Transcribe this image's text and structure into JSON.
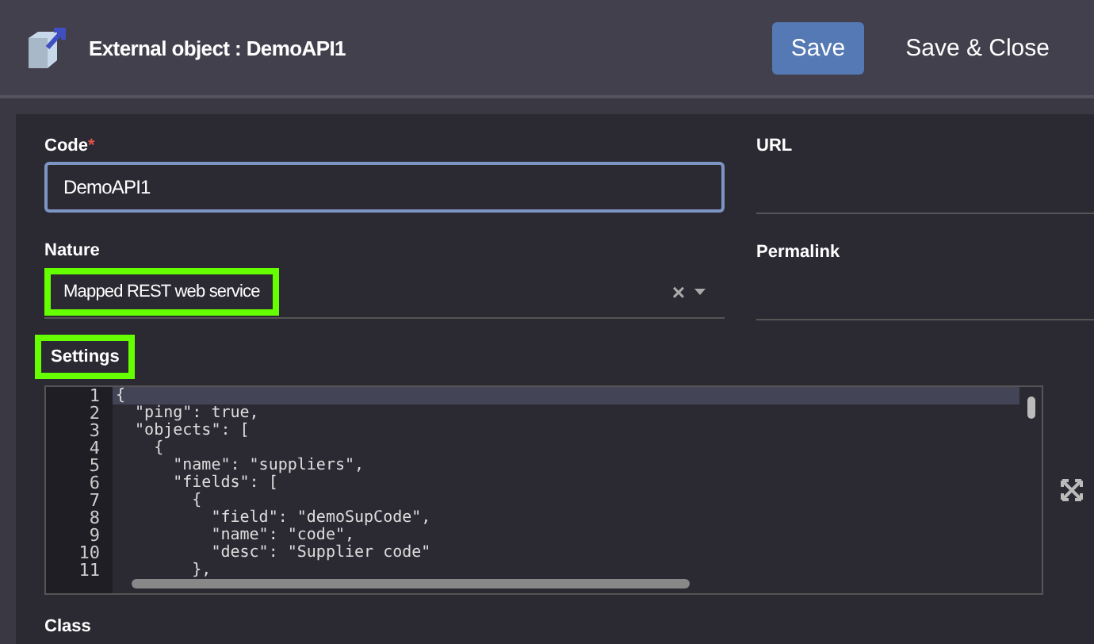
{
  "header": {
    "title": "External object : DemoAPI1",
    "buttons": [
      {
        "label": "Save",
        "kind": "primary"
      },
      {
        "label": "Save & Close",
        "kind": "plain"
      }
    ]
  },
  "form": {
    "code": {
      "label": "Code",
      "required": true,
      "required_mark": "*",
      "value": "DemoAPI1",
      "focused": true
    },
    "url": {
      "label": "URL"
    },
    "nature": {
      "label": "Nature",
      "value": "Mapped REST web service",
      "highlighted": true,
      "clear": "×"
    },
    "permalink": {
      "label": "Permalink"
    },
    "settings": {
      "label": "Settings",
      "highlighted": true,
      "lines": [
        {
          "number": "1",
          "text": "{",
          "active": true
        },
        {
          "number": "2",
          "text": "  \"ping\": true,",
          "active": false
        },
        {
          "number": "3",
          "text": "  \"objects\": [",
          "active": false
        },
        {
          "number": "4",
          "text": "    {",
          "active": false
        },
        {
          "number": "5",
          "text": "      \"name\": \"suppliers\",",
          "active": false
        },
        {
          "number": "6",
          "text": "      \"fields\": [",
          "active": false
        },
        {
          "number": "7",
          "text": "        {",
          "active": false
        },
        {
          "number": "8",
          "text": "          \"field\": \"demoSupCode\",",
          "active": false
        },
        {
          "number": "9",
          "text": "          \"name\": \"code\",",
          "active": false
        },
        {
          "number": "10",
          "text": "          \"desc\": \"Supplier code\"",
          "active": false
        },
        {
          "number": "11",
          "text": "        },",
          "active": false
        }
      ]
    },
    "class": {
      "label": "Class"
    }
  }
}
